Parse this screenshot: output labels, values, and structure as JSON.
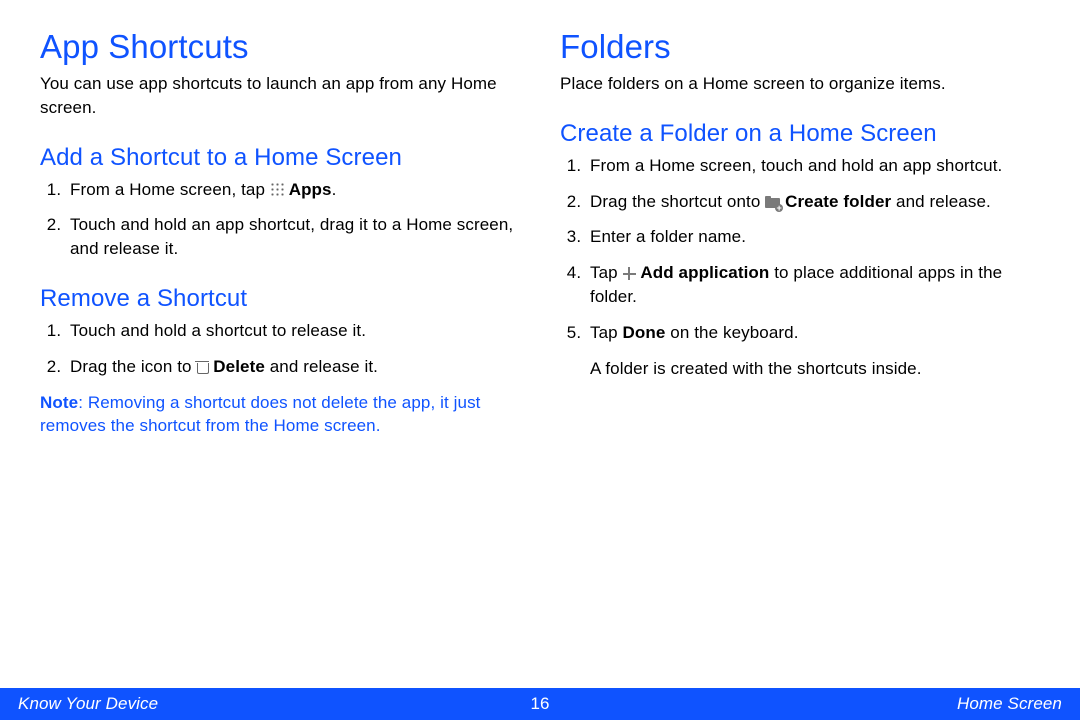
{
  "left": {
    "h1": "App Shortcuts",
    "intro": "You can use app shortcuts to launch an app from any Home screen.",
    "sec1": {
      "title": "Add a Shortcut to a Home Screen",
      "step1_pre": "From a Home screen, tap ",
      "step1_bold": "Apps",
      "step1_post": ".",
      "step2": "Touch and hold an app shortcut, drag it to a Home screen, and release it."
    },
    "sec2": {
      "title": "Remove a Shortcut",
      "step1": "Touch and hold a shortcut to release it.",
      "step2_pre": "Drag the icon to ",
      "step2_bold": "Delete",
      "step2_post": " and release it.",
      "note_label": "Note",
      "note_body": ": Removing a shortcut does not delete the app, it just removes the shortcut from the Home screen."
    }
  },
  "right": {
    "h1": "Folders",
    "intro": "Place folders on a Home screen to organize items.",
    "sec1": {
      "title": "Create a Folder on a Home Screen",
      "step1": "From a Home screen, touch and hold an app shortcut.",
      "step2_pre": "Drag the shortcut onto ",
      "step2_bold": "Create folder",
      "step2_post": " and release.",
      "step3": "Enter a folder name.",
      "step4_pre": "Tap ",
      "step4_bold": "Add application",
      "step4_post": " to place additional apps in the folder.",
      "step5_pre": "Tap ",
      "step5_bold": "Done",
      "step5_post": " on the keyboard.",
      "result": "A folder is created with the shortcuts inside."
    }
  },
  "footer": {
    "left": "Know Your Device",
    "page": "16",
    "right": "Home Screen"
  }
}
